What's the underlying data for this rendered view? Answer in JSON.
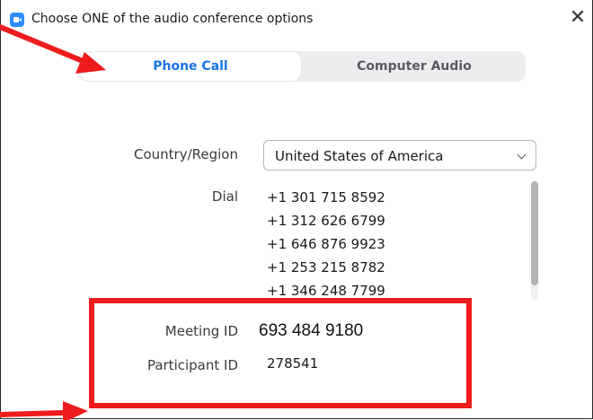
{
  "window": {
    "title": "Choose ONE of the audio conference options",
    "close_glyph": "✕"
  },
  "tabs": [
    {
      "label": "Phone Call",
      "selected": true
    },
    {
      "label": "Computer Audio",
      "selected": false
    }
  ],
  "form": {
    "country_label": "Country/Region",
    "country_value": "United States of America",
    "dial_label": "Dial",
    "dial_numbers": [
      "+1 301 715 8592",
      "+1 312 626 6799",
      "+1 646 876 9923",
      "+1 253 215 8782",
      "+1 346 248 7799"
    ],
    "meeting_id_label": "Meeting ID",
    "meeting_id_value": "693 484 9180",
    "participant_id_label": "Participant ID",
    "participant_id_value": "278541"
  },
  "icons": {
    "app": "zoom-camera-icon",
    "close": "close-icon",
    "dropdown": "chevron-down-icon"
  },
  "colors": {
    "accent": "#1a73e8",
    "annotation": "#ee1c1c",
    "zoom_blue": "#2d8cff"
  }
}
